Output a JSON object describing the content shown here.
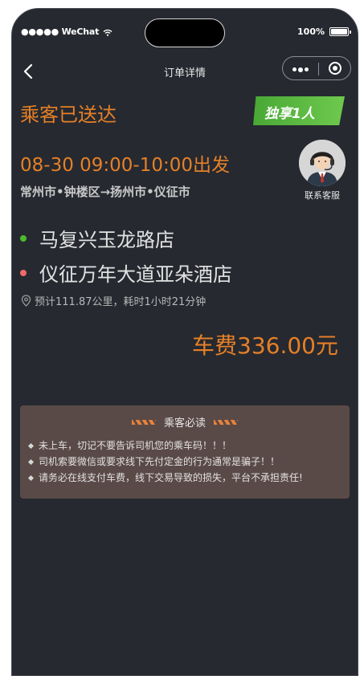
{
  "status_bar": {
    "carrier": "●●●●● WeChat",
    "battery": "100%"
  },
  "nav": {
    "title": "订单详情"
  },
  "order": {
    "status": "乘客已送达",
    "badge": "独享1人",
    "departure": "08-30 09:00-10:00出发",
    "route": "常州市•钟楼区→扬州市•仪征市",
    "service_label": "联系客服",
    "pickup": "马复兴玉龙路店",
    "dropoff": "仪征万年大道亚朵酒店",
    "estimate": "预计111.87公里，耗时1小时21分钟",
    "fare": "车费336.00元"
  },
  "notice": {
    "title": "乘客必读",
    "items": [
      "未上车，切记不要告诉司机您的乘车码！！！",
      "司机索要微信或要求线下先付定金的行为通常是骗子！！",
      "请务必在线支付车费，线下交易导致的损失，平台不承担责任!"
    ]
  },
  "colors": {
    "accent": "#e58027",
    "badge": "#5cba40",
    "pickup_dot": "#4cbb2f",
    "dropoff_dot": "#ef6a6a"
  }
}
